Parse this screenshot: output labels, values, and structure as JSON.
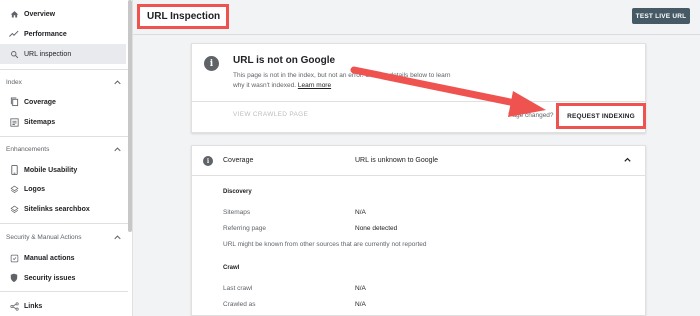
{
  "header": {
    "title": "URL Inspection",
    "test_live_label": "TEST LIVE URL"
  },
  "sidebar": {
    "top_items": [
      {
        "label": "Overview",
        "icon": "home-icon"
      },
      {
        "label": "Performance",
        "icon": "trending-up-icon"
      },
      {
        "label": "URL inspection",
        "icon": "search-icon"
      }
    ],
    "sections": [
      {
        "title": "Index",
        "items": [
          {
            "label": "Coverage",
            "icon": "file-copy-icon"
          },
          {
            "label": "Sitemaps",
            "icon": "sitemap-icon"
          }
        ]
      },
      {
        "title": "Enhancements",
        "items": [
          {
            "label": "Mobile Usability",
            "icon": "phone-icon"
          },
          {
            "label": "Logos",
            "icon": "layers-icon"
          },
          {
            "label": "Sitelinks searchbox",
            "icon": "layers-icon"
          }
        ]
      },
      {
        "title": "Security & Manual Actions",
        "items": [
          {
            "label": "Manual actions",
            "icon": "manual-action-icon"
          },
          {
            "label": "Security issues",
            "icon": "shield-icon"
          }
        ]
      }
    ],
    "bottom_items": [
      {
        "label": "Links",
        "icon": "links-icon"
      }
    ]
  },
  "status_card": {
    "title": "URL is not on Google",
    "desc_line1": "This page is not in the index, but not",
    "desc_line1b": "an error. See the details below to learn",
    "desc_line2": "why it wasn't indexed.",
    "learn_more": "Learn more",
    "view_crawled": "VIEW CRAWLED PAGE",
    "page_changed": "Page changed?",
    "request_indexing": "REQUEST INDEXING"
  },
  "coverage": {
    "label": "Coverage",
    "status": "URL is unknown to Google",
    "discovery": {
      "heading": "Discovery",
      "rows": [
        {
          "key": "Sitemaps",
          "value": "N/A"
        },
        {
          "key": "Referring page",
          "value": "None detected"
        }
      ],
      "note": "URL might be known from other sources that are currently not reported"
    },
    "crawl": {
      "heading": "Crawl",
      "rows": [
        {
          "key": "Last crawl",
          "value": "N/A"
        },
        {
          "key": "Crawled as",
          "value": "N/A"
        }
      ]
    }
  },
  "colors": {
    "highlight": "#ef5350",
    "button_dark": "#455a64"
  }
}
